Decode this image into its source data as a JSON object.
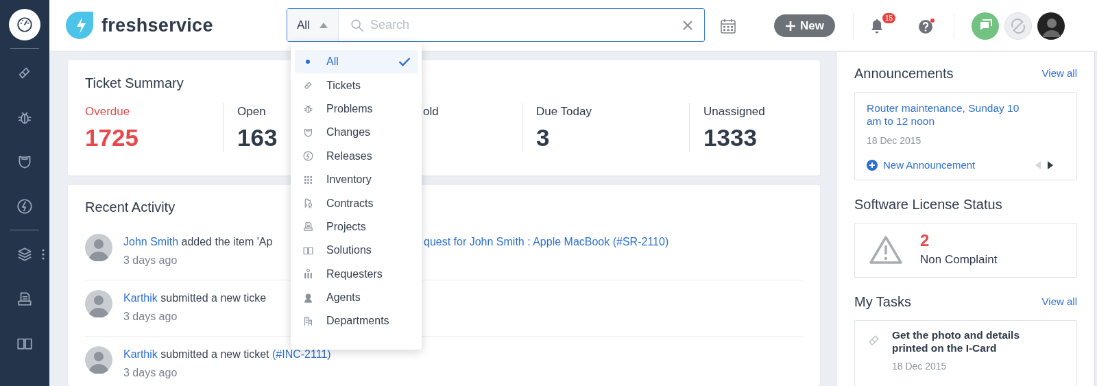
{
  "sidebar": {
    "items": [
      {
        "selected": true
      },
      {
        "selected": false
      },
      {
        "selected": false
      },
      {
        "selected": false
      },
      {
        "selected": false
      },
      {
        "selected": false
      },
      {
        "selected": false
      },
      {
        "selected": false
      }
    ]
  },
  "header": {
    "brand": "freshservice",
    "search": {
      "scope": "All",
      "placeholder": "Search"
    },
    "new_button": "New",
    "notifications": "15"
  },
  "scope_menu": [
    {
      "label": "All",
      "selected": true
    },
    {
      "label": "Tickets",
      "selected": false
    },
    {
      "label": "Problems",
      "selected": false
    },
    {
      "label": "Changes",
      "selected": false
    },
    {
      "label": "Releases",
      "selected": false
    },
    {
      "label": "Inventory",
      "selected": false
    },
    {
      "label": "Contracts",
      "selected": false
    },
    {
      "label": "Projects",
      "selected": false
    },
    {
      "label": "Solutions",
      "selected": false
    },
    {
      "label": "Requesters",
      "selected": false
    },
    {
      "label": "Agents",
      "selected": false
    },
    {
      "label": "Departments",
      "selected": false
    }
  ],
  "ticket_summary": {
    "title": "Ticket Summary",
    "stats": [
      {
        "label": "Overdue",
        "value": "1725",
        "kind": "alert"
      },
      {
        "label": "Open",
        "value": "163",
        "kind": "normal"
      },
      {
        "label": "old",
        "kind": "normal"
      },
      {
        "label": "Due Today",
        "value": "3",
        "kind": "normal"
      },
      {
        "label": "Unassigned",
        "value": "1333",
        "kind": "normal"
      }
    ]
  },
  "recent_activity": {
    "title": "Recent Activity",
    "items": [
      {
        "parts": [
          {
            "kind": "user",
            "text": "John Smith"
          },
          {
            "kind": "text",
            "text": " added the item 'Ap"
          },
          {
            "kind": "covered"
          },
          {
            "kind": "link",
            "text": "quest for John Smith : Apple MacBook (#SR-2110)"
          }
        ],
        "time": "3 days ago"
      },
      {
        "parts": [
          {
            "kind": "user",
            "text": "Karthik"
          },
          {
            "kind": "text",
            "text": " submitted a new ticke"
          }
        ],
        "time": "3 days ago"
      },
      {
        "parts": [
          {
            "kind": "user",
            "text": "Karthik"
          },
          {
            "kind": "text",
            "text": " submitted a new ticket "
          },
          {
            "kind": "link",
            "text": "(#INC-2111)"
          }
        ],
        "time": "3 days ago"
      }
    ]
  },
  "announcements": {
    "title": "Announcements",
    "view_all": "View all",
    "item": {
      "title": "Router maintenance, Sunday 10 am to 12 noon",
      "date": "18 Dec 2015"
    },
    "new_link": "New Announcement",
    "prev_disabled": true,
    "next_disabled": false
  },
  "license_status": {
    "title": "Software License Status",
    "count": "2",
    "label": "Non Complaint"
  },
  "my_tasks": {
    "title": "My Tasks",
    "view_all": "View all",
    "items": [
      {
        "title": "Get the photo and details printed on the I-Card",
        "date": "18 Dec 2015"
      }
    ]
  }
}
